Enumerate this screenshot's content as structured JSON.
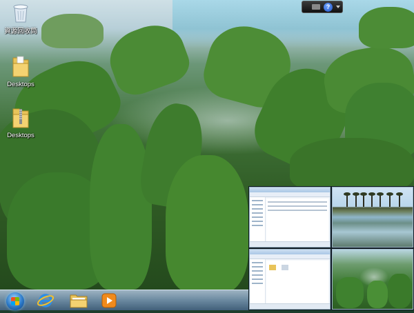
{
  "desktop": {
    "icons": [
      {
        "name": "recycle-bin",
        "label": "資源回收筒"
      },
      {
        "name": "folder-1",
        "label": "Desktops"
      },
      {
        "name": "folder-2",
        "label": "Desktops"
      }
    ]
  },
  "gadget": {
    "help_label": "?"
  },
  "taskbar": {
    "items": [
      {
        "name": "start",
        "icon": "windows-start-orb"
      },
      {
        "name": "internet-explorer",
        "icon": "internet-explorer-icon"
      },
      {
        "name": "file-explorer",
        "icon": "folder-icon"
      },
      {
        "name": "media-player",
        "icon": "media-player-icon"
      }
    ]
  },
  "thumbnails": [
    {
      "name": "explorer-window-1",
      "kind": "explorer"
    },
    {
      "name": "photo-rice-field",
      "kind": "photo"
    },
    {
      "name": "explorer-window-2",
      "kind": "explorer"
    },
    {
      "name": "photo-green-rocks",
      "kind": "photo"
    }
  ]
}
